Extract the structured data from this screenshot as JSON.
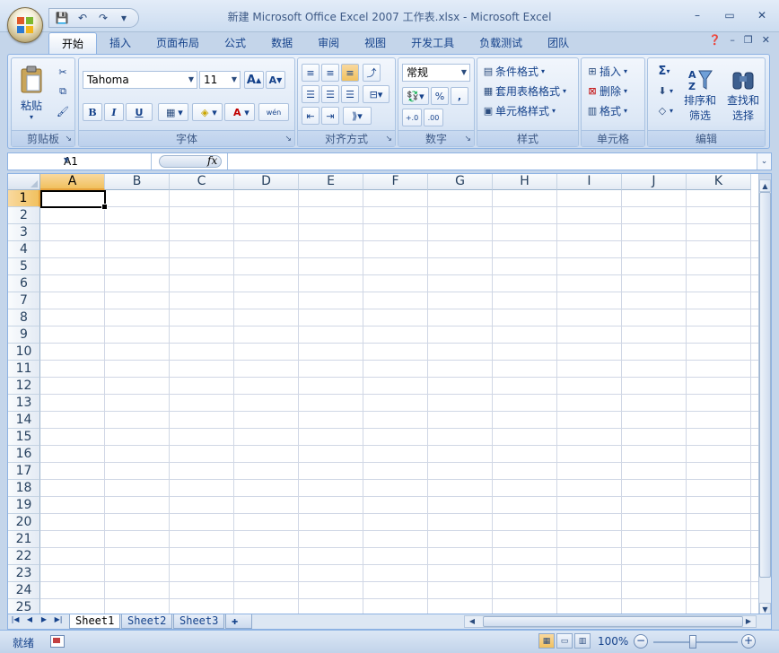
{
  "window": {
    "title": "新建 Microsoft Office Excel 2007 工作表.xlsx - Microsoft Excel",
    "buttons": {
      "minimize": "–",
      "maximize": "▭",
      "close": "✕"
    }
  },
  "qat": {
    "save": "💾",
    "undo": "↶",
    "redo": "↷",
    "customize": "▾"
  },
  "tabs": [
    "开始",
    "插入",
    "页面布局",
    "公式",
    "数据",
    "审阅",
    "视图",
    "开发工具",
    "负载测试",
    "团队"
  ],
  "ribbon": {
    "clipboard": {
      "label": "剪贴板",
      "paste": "粘贴"
    },
    "font": {
      "label": "字体",
      "name": "Tahoma",
      "size": "11",
      "bold": "B",
      "italic": "I",
      "underline": "U",
      "grow": "A",
      "shrink": "A",
      "phonetic": "wén"
    },
    "alignment": {
      "label": "对齐方式"
    },
    "number": {
      "label": "数字",
      "format": "常规",
      "percent": "%",
      "comma": ",",
      "inc": "+.0",
      "dec": ".00"
    },
    "styles": {
      "label": "样式",
      "conditional": "条件格式",
      "table": "套用表格格式",
      "cell": "单元格样式"
    },
    "cells": {
      "label": "单元格",
      "insert": "插入",
      "delete": "删除",
      "format": "格式"
    },
    "editing": {
      "label": "编辑",
      "sum": "Σ",
      "sort": "排序和\n筛选",
      "sort_l1": "排序和",
      "sort_l2": "筛选",
      "find_l1": "查找和",
      "find_l2": "选择"
    }
  },
  "formula_bar": {
    "name_box": "A1",
    "fx": "fx"
  },
  "sheet": {
    "columns": [
      "A",
      "B",
      "C",
      "D",
      "E",
      "F",
      "G",
      "H",
      "I",
      "J",
      "K"
    ],
    "rows": [
      "1",
      "2",
      "3",
      "4",
      "5",
      "6",
      "7",
      "8",
      "9",
      "10",
      "11",
      "12",
      "13",
      "14",
      "15",
      "16",
      "17",
      "18",
      "19",
      "20",
      "21",
      "22",
      "23",
      "24",
      "25"
    ],
    "selected_cell": "A1"
  },
  "sheet_tabs": [
    "Sheet1",
    "Sheet2",
    "Sheet3"
  ],
  "status": {
    "ready": "就绪",
    "zoom": "100%",
    "zoom_fraction": 0.5
  }
}
